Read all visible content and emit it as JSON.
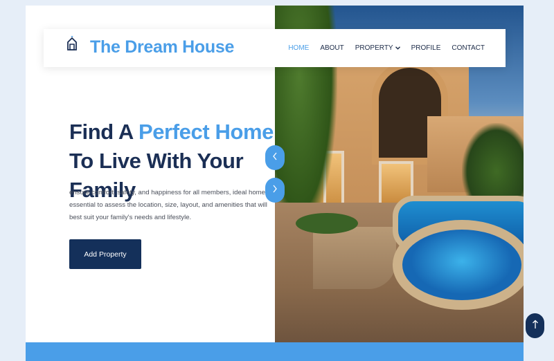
{
  "brand": {
    "name": "The Dream House",
    "logo_icon": "house-outline-icon"
  },
  "nav": {
    "items": [
      {
        "label": "HOME",
        "active": true
      },
      {
        "label": "ABOUT",
        "active": false
      },
      {
        "label": "PROPERTY",
        "active": false,
        "icon": "chevron-down-icon"
      },
      {
        "label": "PROFILE",
        "active": false
      },
      {
        "label": "CONTACT",
        "active": false
      }
    ]
  },
  "hero": {
    "headline_part1": "Find A ",
    "headline_accent": "Perfect Home",
    "headline_part2": " To Live With Your Family",
    "lead": "ensure comfort, safety, and happiness for all members, ideal home it is essential to assess the location, size, layout, and amenities that will best suit your family's needs and lifestyle.",
    "cta_label": "Add Property"
  },
  "slider": {
    "prev_icon": "chevron-left-icon",
    "next_icon": "chevron-right-icon"
  },
  "back_to_top": {
    "icon": "arrow-up-icon"
  },
  "colors": {
    "accent": "#4a9ee8",
    "navy": "#14305a",
    "heading": "#1b2f55",
    "page_bg": "#e6eef8"
  }
}
